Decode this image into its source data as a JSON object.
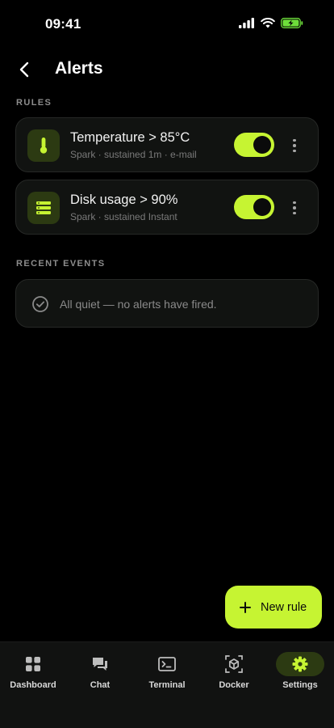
{
  "status_bar": {
    "time": "09:41"
  },
  "header": {
    "title": "Alerts"
  },
  "sections": {
    "rules_label": "RULES",
    "events_label": "RECENT EVENTS"
  },
  "rules": [
    {
      "title": "Temperature > 85°C",
      "subtitle": "Spark · sustained 1m · e-mail",
      "icon": "thermometer-icon",
      "enabled": true
    },
    {
      "title": "Disk usage > 90%",
      "subtitle": "Spark · sustained Instant",
      "icon": "server-stack-icon",
      "enabled": true
    }
  ],
  "events": {
    "empty_text": "All quiet — no alerts have fired."
  },
  "fab": {
    "label": "New rule"
  },
  "nav": {
    "items": [
      {
        "label": "Dashboard",
        "icon": "grid-icon"
      },
      {
        "label": "Chat",
        "icon": "chat-icon"
      },
      {
        "label": "Terminal",
        "icon": "terminal-icon"
      },
      {
        "label": "Docker",
        "icon": "container-icon"
      },
      {
        "label": "Settings",
        "icon": "gear-icon"
      }
    ],
    "active": "Settings"
  },
  "colors": {
    "accent": "#c6f432",
    "accent_dim": "#2c3a12",
    "card": "#111311",
    "background": "#000000"
  }
}
